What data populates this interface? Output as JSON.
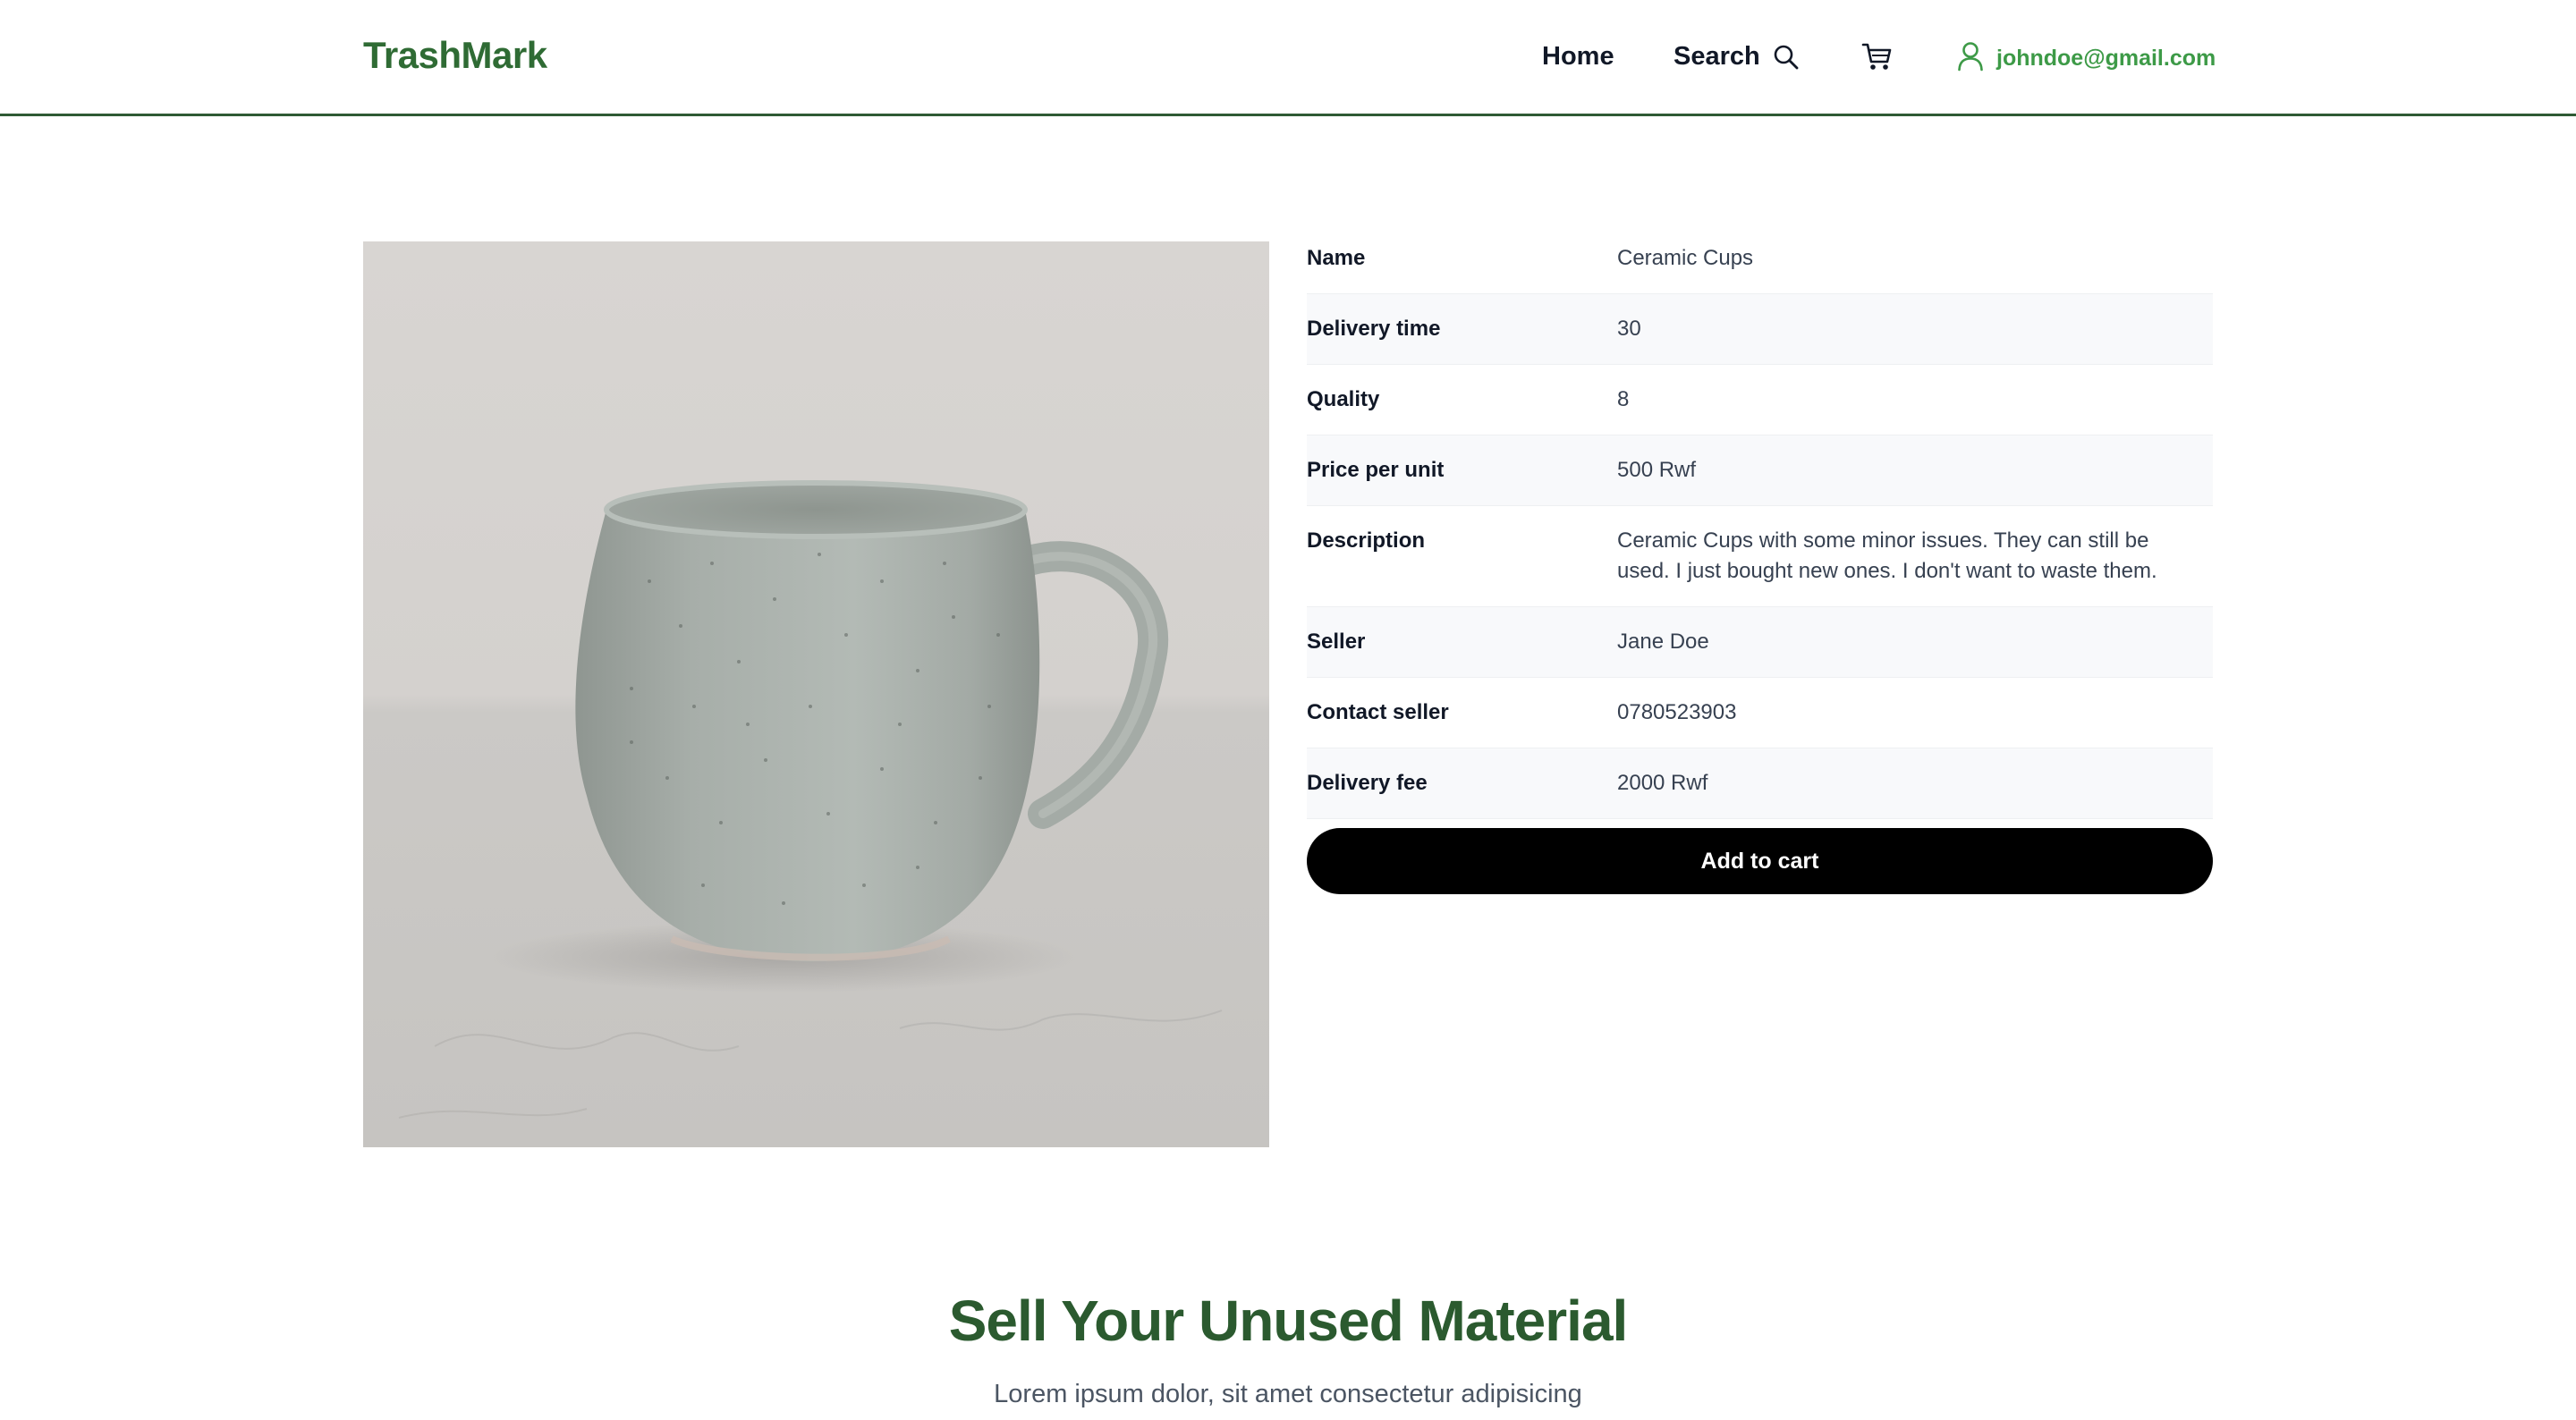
{
  "header": {
    "brand": "TrashMark",
    "nav": {
      "home": "Home",
      "search": "Search",
      "user_email": "johndoe@gmail.com"
    },
    "icons": [
      "search-icon",
      "cart-icon",
      "user-icon"
    ],
    "colors": {
      "brand": "#2f6b34",
      "user_email": "#3d9a47",
      "divider": "#2f5a34"
    }
  },
  "product": {
    "image_alt": "Ceramic Cups",
    "details": [
      {
        "label": "Name",
        "value": "Ceramic Cups"
      },
      {
        "label": "Delivery time",
        "value": "30"
      },
      {
        "label": "Quality",
        "value": "8"
      },
      {
        "label": "Price per unit",
        "value": "500 Rwf"
      },
      {
        "label": "Description",
        "value": "Ceramic Cups with some minor issues. They can still be used. I just bought new ones. I don't want to waste them."
      },
      {
        "label": "Seller",
        "value": "Jane Doe"
      },
      {
        "label": "Contact seller",
        "value": "0780523903"
      },
      {
        "label": "Delivery fee",
        "value": "2000 Rwf"
      }
    ],
    "add_to_cart_label": "Add to cart"
  },
  "sell_section": {
    "title": "Sell Your Unused Material",
    "subtitle": "Lorem ipsum dolor, sit amet consectetur adipisicing",
    "colors": {
      "title": "#2b5a2f"
    }
  }
}
